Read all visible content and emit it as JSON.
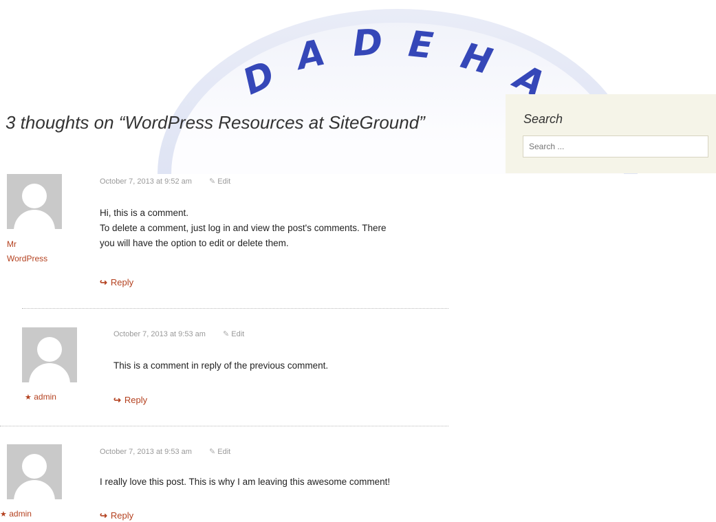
{
  "watermark": {
    "letters": [
      "D",
      "A",
      "D",
      "E",
      "H",
      "A"
    ]
  },
  "sidebar": {
    "title": "Search",
    "search_placeholder": "Search ..."
  },
  "comments_title": "3 thoughts on “WordPress Resources at SiteGround”",
  "comments": [
    {
      "author_line1": "Mr",
      "author_line2": "WordPress",
      "date": "October 7, 2013 at 9:52 am",
      "edit_label": "Edit",
      "text_lines": [
        "Hi, this is a comment.",
        "To delete a comment, just log in and view the post's comments. There",
        "you will have the option to edit or delete them."
      ],
      "reply_label": "Reply"
    },
    {
      "author_star": "★",
      "author": "admin",
      "date": "October 7, 2013 at 9:53 am",
      "edit_label": "Edit",
      "text_lines": [
        "This is a comment in reply of the previous comment."
      ],
      "reply_label": "Reply"
    },
    {
      "author_star": "★",
      "author": "admin",
      "date": "October 7, 2013 at 9:53 am",
      "edit_label": "Edit",
      "text_lines": [
        "I really love this post. This is why I am leaving this awesome comment!"
      ],
      "reply_label": "Reply"
    }
  ],
  "icons": {
    "reply": "reply-arrow-icon",
    "edit": "pencil-icon",
    "author": "star-icon"
  },
  "colors": {
    "link": "#b4411f",
    "sidebar_bg": "#f5f4e8",
    "watermark": "#3547b8"
  }
}
